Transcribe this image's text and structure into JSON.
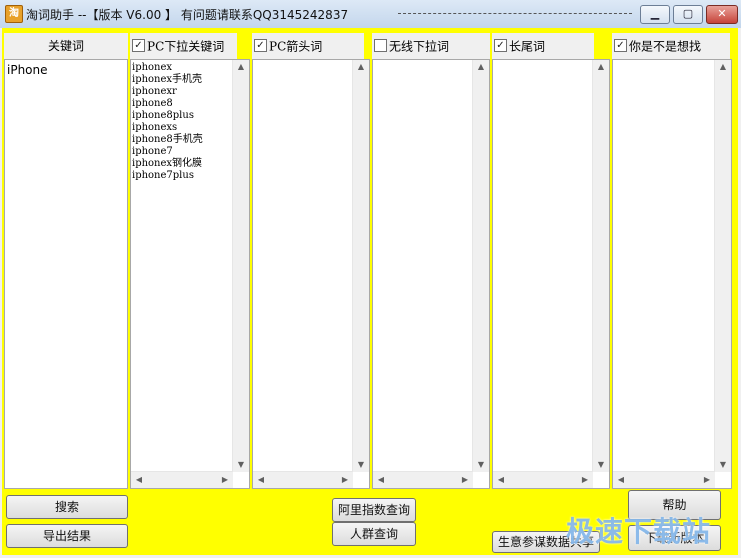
{
  "window": {
    "title": "淘词助手 --【版本 V6.00 】 有问题请联系QQ3145242837",
    "icon": "app-icon-taoci",
    "controls": {
      "minimize": "▭",
      "maximize": "▢",
      "close": "✕"
    }
  },
  "keyword_panel": {
    "header": "关键词",
    "value": "iPhone"
  },
  "columns": [
    {
      "label": "PC下拉关键词",
      "checked": true,
      "items": [
        "iphonex",
        "iphonex手机壳",
        "iphonexr",
        "iphone8",
        "iphone8plus",
        "iphonexs",
        "iphone8手机壳",
        "iphone7",
        "iphonex钢化膜",
        "iphone7plus"
      ]
    },
    {
      "label": "PC箭头词",
      "checked": true,
      "items": []
    },
    {
      "label": "无线下拉词",
      "checked": false,
      "items": []
    },
    {
      "label": "长尾词",
      "checked": true,
      "items": []
    },
    {
      "label": "你是不是想找",
      "checked": true,
      "items": []
    }
  ],
  "buttons": {
    "search": "搜索",
    "export": "导出结果",
    "ali_index": "阿里指数查询",
    "crowd": "人群查询",
    "help": "帮助",
    "download": "下载新版本",
    "biz_data": "生意参谋数据共享"
  },
  "watermark": "极速下载站",
  "colors": {
    "client_bg": "#ffff00",
    "title_bg": "#c3d6ec"
  }
}
